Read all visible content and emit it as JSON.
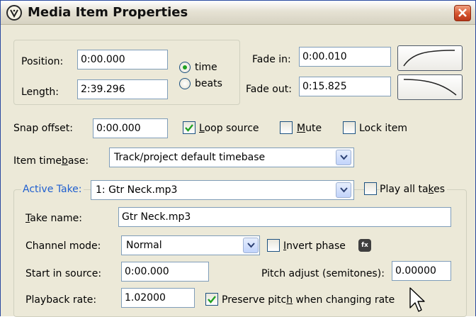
{
  "window": {
    "title": "Media Item Properties"
  },
  "position": {
    "label": "Position:",
    "value": "0:00.000"
  },
  "length": {
    "label": "Length:",
    "value": "2:39.296"
  },
  "timemode": {
    "time": "time",
    "beats": "beats",
    "selected": "time"
  },
  "fade_in": {
    "label": "Fade in:",
    "value": "0:00.010"
  },
  "fade_out": {
    "label": "Fade out:",
    "value": "0:15.825"
  },
  "snap_offset": {
    "label": "Snap offset:",
    "value": "0:00.000"
  },
  "loop_source": {
    "label_pre": "",
    "ul": "L",
    "label_post": "oop source",
    "checked": true
  },
  "mute": {
    "ul": "M",
    "label_post": "ute",
    "checked": false
  },
  "lock_item": {
    "label": "Lock item",
    "checked": false
  },
  "item_timebase": {
    "label_pre": "Item time",
    "ul": "b",
    "label_post": "ase:",
    "value": "Track/project default timebase"
  },
  "active_take": {
    "label": "Active Take:",
    "value": "1: Gtr Neck.mp3"
  },
  "play_all_takes": {
    "label_pre": "Play all ta",
    "ul": "k",
    "label_post": "es",
    "checked": false
  },
  "take_name": {
    "ul": "T",
    "label_post": "ake name:",
    "value": "Gtr Neck.mp3"
  },
  "channel_mode": {
    "label": "Channel mode:",
    "value": "Normal"
  },
  "invert_phase": {
    "ul": "I",
    "label_post": "nvert phase",
    "checked": false
  },
  "fx_button": {
    "label": "fx"
  },
  "start_in_source": {
    "label": "Start in source:",
    "value": "0:00.000"
  },
  "pitch_adjust": {
    "label": "Pitch adjust (semitones):",
    "value": "0.00000"
  },
  "playback_rate": {
    "label": "Playback rate:",
    "value": "1.02000"
  },
  "preserve_pitch": {
    "label_pre": "Preserve pitc",
    "ul": "h",
    "label_post": " when changing rate",
    "checked": true
  }
}
